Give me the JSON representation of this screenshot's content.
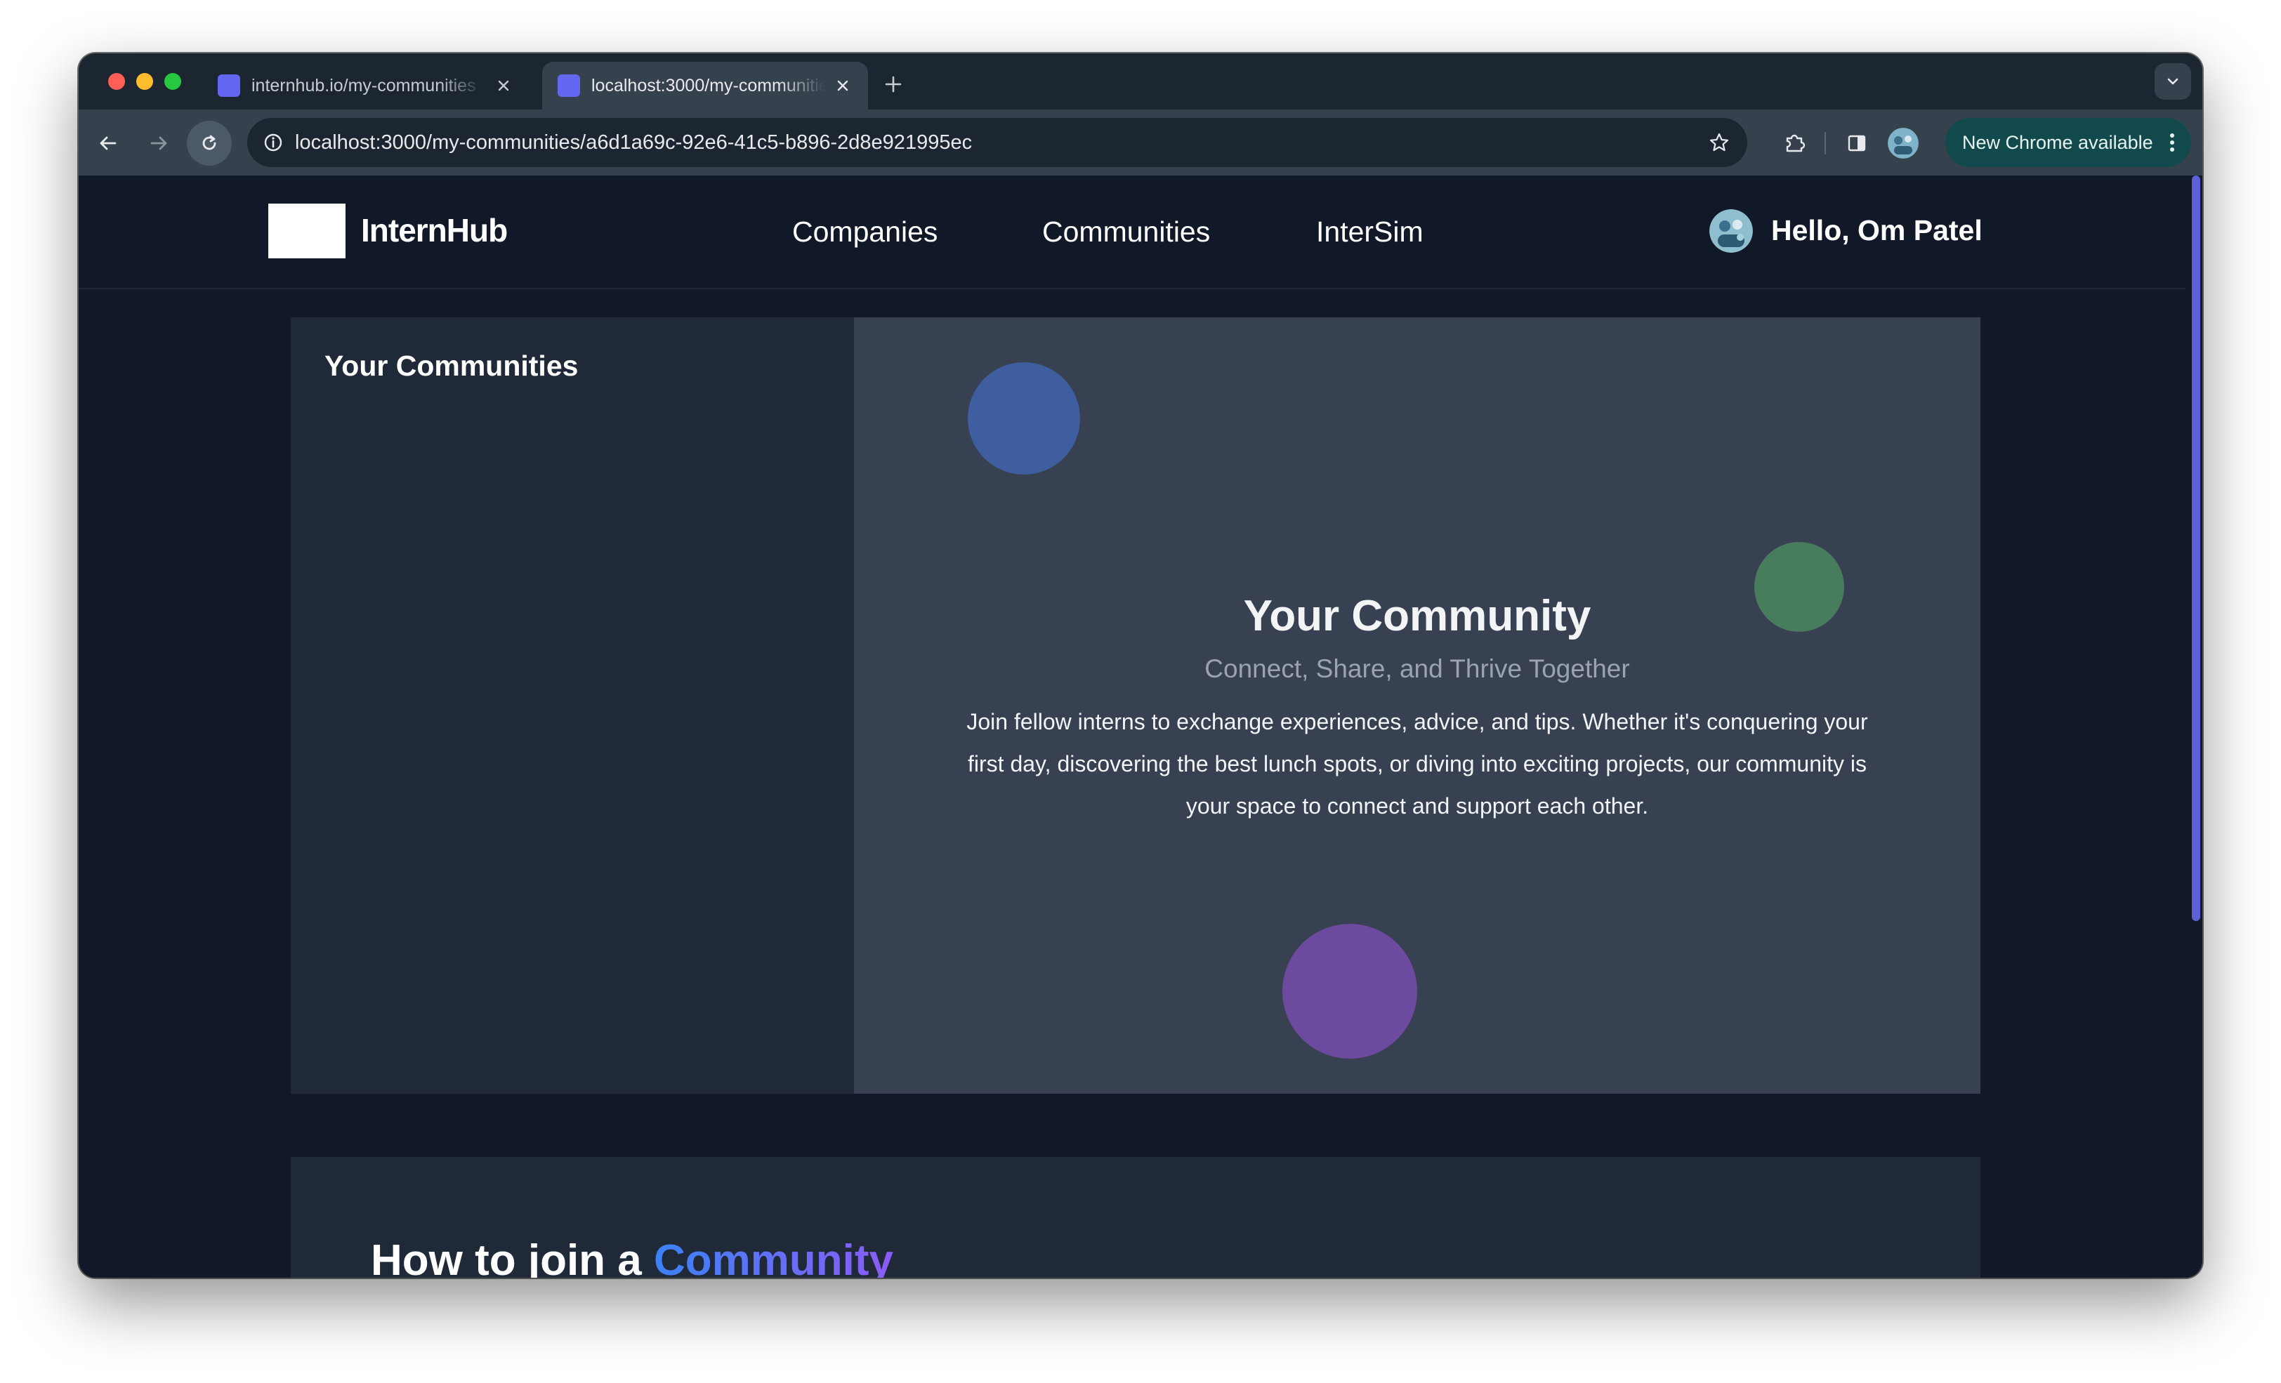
{
  "browser": {
    "tabs": [
      {
        "title": "internhub.io/my-communities",
        "active": false
      },
      {
        "title": "localhost:3000/my-communities",
        "active": true
      }
    ],
    "address_url": "localhost:3000/my-communities/a6d1a69c-92e6-41c5-b896-2d8e921995ec",
    "update_label": "New Chrome available"
  },
  "site": {
    "brand": "InternHub",
    "nav": [
      {
        "label": "Companies"
      },
      {
        "label": "Communities"
      },
      {
        "label": "InterSim"
      }
    ],
    "greeting": "Hello, Om Patel"
  },
  "sidebar": {
    "title": "Your Communities"
  },
  "hero": {
    "title": "Your Community",
    "subtitle": "Connect, Share, and Thrive Together",
    "body": "Join fellow interns to exchange experiences, advice, and tips. Whether it's conquering your first day, discovering the best lunch spots, or diving into exciting projects, our community is your space to connect and support each other."
  },
  "join": {
    "title_prefix": "How to join a",
    "title_highlight": "Community"
  },
  "colors": {
    "page_bg": "#111827",
    "panel_bg": "#1f2937",
    "hero_bg": "#374151",
    "favicon": "#6366f1",
    "circle_blue": "#3f5e9f",
    "circle_green": "#477c5c",
    "circle_purple": "#6c4b9f",
    "accent_gradient": [
      "#3b82f6",
      "#8b5cf6"
    ]
  },
  "icons": {
    "tab_close": "close-icon",
    "new_tab": "plus-icon",
    "tab_search": "chevron-down-icon",
    "back": "arrow-left-icon",
    "forward": "arrow-right-icon",
    "reload": "reload-icon",
    "site_info": "info-icon",
    "bookmark": "star-icon",
    "extensions": "puzzle-icon",
    "side_panel": "side-panel-icon",
    "menu": "kebab-menu-icon"
  }
}
